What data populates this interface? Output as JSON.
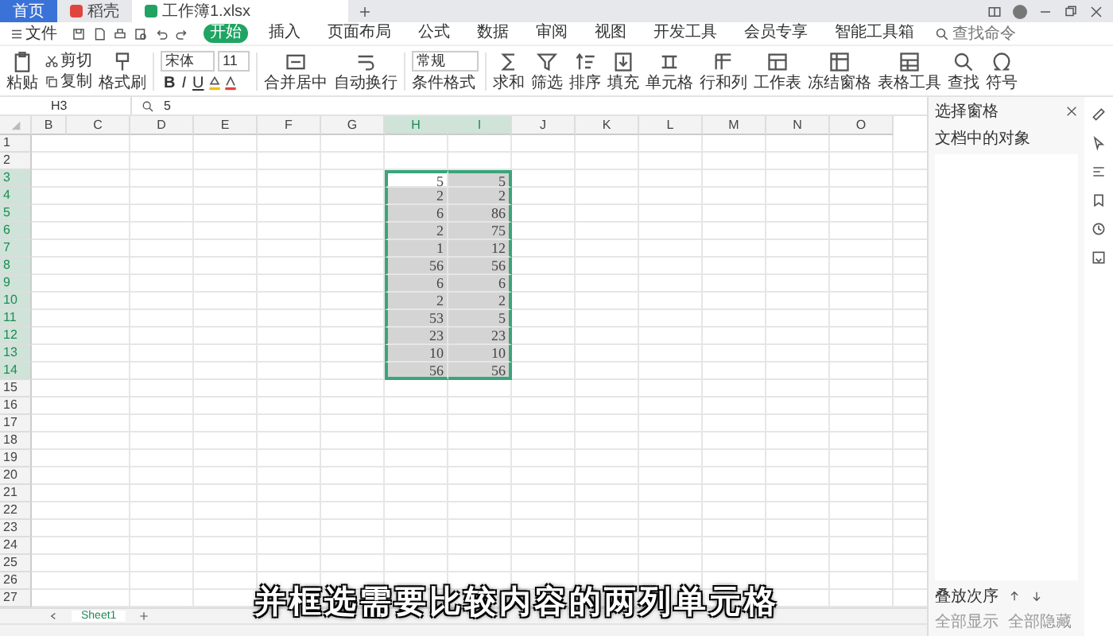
{
  "title_tabs": [
    {
      "label": "首页",
      "kind": "home",
      "selected": false
    },
    {
      "label": "稻壳",
      "kind": "docer",
      "selected": false
    },
    {
      "label": "工作簿1.xlsx",
      "kind": "sheet",
      "selected": true
    }
  ],
  "menu": {
    "file": "文件",
    "tabs": [
      {
        "label": "开始",
        "selected": true
      },
      {
        "label": "插入",
        "selected": false
      },
      {
        "label": "页面布局",
        "selected": false
      },
      {
        "label": "公式",
        "selected": false
      },
      {
        "label": "数据",
        "selected": false
      },
      {
        "label": "审阅",
        "selected": false
      },
      {
        "label": "视图",
        "selected": false
      },
      {
        "label": "开发工具",
        "selected": false
      },
      {
        "label": "会员专享",
        "selected": false
      },
      {
        "label": "智能工具箱",
        "selected": false
      }
    ],
    "search": {
      "placeholder": "查找命令"
    }
  },
  "toolbar": {
    "paste": "粘贴",
    "cut": "剪切",
    "copy": "复制",
    "format_painter": "格式刷",
    "font": {
      "name": "宋体",
      "size": "11",
      "styles": [
        "B",
        "I",
        "U"
      ]
    },
    "merge": "合并居中",
    "wrap": "自动换行",
    "number_format": "常规",
    "conditional": "条件格式",
    "tools": [
      "求和",
      "筛选",
      "排序",
      "填充",
      "单元格",
      "行和列",
      "工作表",
      "冻结窗格",
      "表格工具",
      "查找",
      "符号"
    ]
  },
  "formula_bar": {
    "cell_ref": "H3",
    "formula": "5"
  },
  "sheet": {
    "columns": [
      {
        "label": "B",
        "selected": false
      },
      {
        "label": "C",
        "selected": false
      },
      {
        "label": "D",
        "selected": false
      },
      {
        "label": "E",
        "selected": false
      },
      {
        "label": "F",
        "selected": false
      },
      {
        "label": "G",
        "selected": false
      },
      {
        "label": "H",
        "selected": true,
        "values": [
          "5",
          "2",
          "6",
          "2",
          "1",
          "56",
          "6",
          "2",
          "53",
          "23",
          "10",
          "56"
        ]
      },
      {
        "label": "I",
        "selected": true,
        "values": [
          "5",
          "2",
          "86",
          "75",
          "12",
          "56",
          "6",
          "2",
          "5",
          "23",
          "10",
          "56"
        ]
      },
      {
        "label": "J",
        "selected": false
      },
      {
        "label": "K",
        "selected": false
      },
      {
        "label": "L",
        "selected": false
      },
      {
        "label": "M",
        "selected": false
      },
      {
        "label": "N",
        "selected": false
      },
      {
        "label": "O",
        "selected": false
      }
    ],
    "rows": [
      {
        "label": "1",
        "selected": false
      },
      {
        "label": "2",
        "selected": false
      },
      {
        "label": "3",
        "selected": true
      },
      {
        "label": "4",
        "selected": true
      },
      {
        "label": "5",
        "selected": true
      },
      {
        "label": "6",
        "selected": true
      },
      {
        "label": "7",
        "selected": true
      },
      {
        "label": "8",
        "selected": true
      },
      {
        "label": "9",
        "selected": true
      },
      {
        "label": "10",
        "selected": true
      },
      {
        "label": "11",
        "selected": true
      },
      {
        "label": "12",
        "selected": true
      },
      {
        "label": "13",
        "selected": true
      },
      {
        "label": "14",
        "selected": true
      },
      {
        "label": "15",
        "selected": false
      },
      {
        "label": "16",
        "selected": false
      },
      {
        "label": "17",
        "selected": false
      },
      {
        "label": "18",
        "selected": false
      },
      {
        "label": "19",
        "selected": false
      },
      {
        "label": "20",
        "selected": false
      },
      {
        "label": "21",
        "selected": false
      },
      {
        "label": "22",
        "selected": false
      },
      {
        "label": "23",
        "selected": false
      },
      {
        "label": "24",
        "selected": false
      },
      {
        "label": "25",
        "selected": false
      },
      {
        "label": "26",
        "selected": false
      },
      {
        "label": "27",
        "selected": false
      }
    ],
    "sheet_tabs": [
      {
        "label": "Sheet1",
        "selected": true
      }
    ]
  },
  "selection_pane": {
    "title": "选择窗格",
    "heading": "文档中的对象",
    "order_label": "叠放次序",
    "buttons": [
      "全部显示",
      "全部隐藏"
    ]
  },
  "caption": "并框选需要比较内容的两列单元格"
}
